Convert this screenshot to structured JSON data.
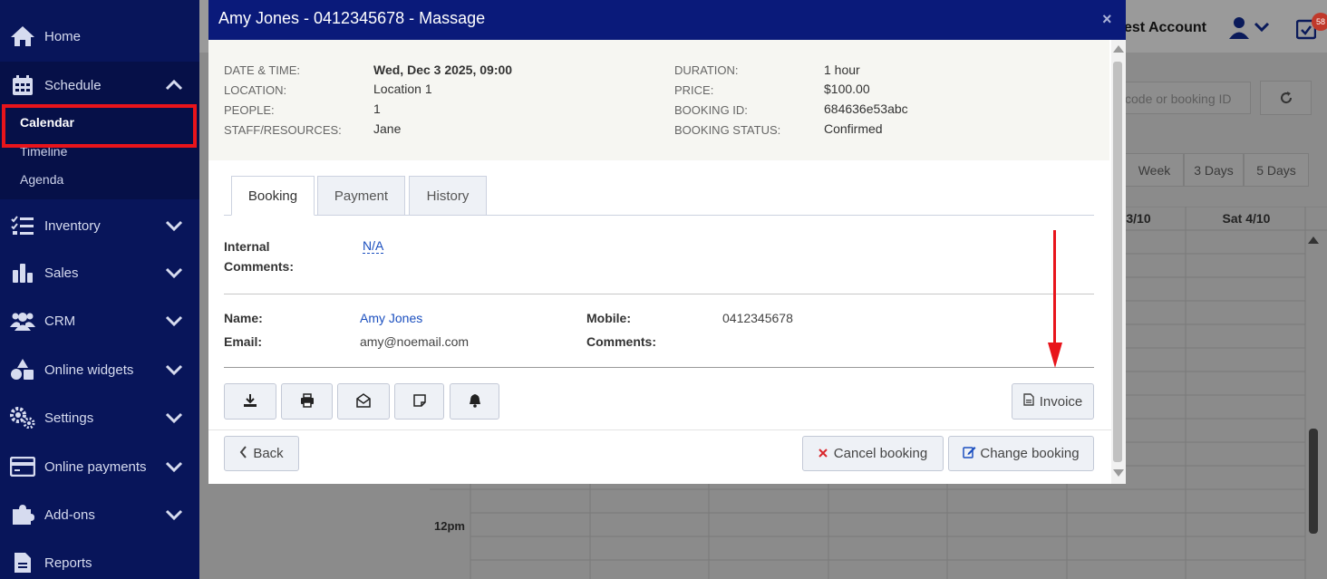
{
  "sidebar": {
    "items": [
      {
        "label": "Home",
        "icon": "home-icon"
      },
      {
        "label": "Schedule",
        "icon": "calendar-grid-icon"
      },
      {
        "label": "Inventory",
        "icon": "checklist-icon"
      },
      {
        "label": "Sales",
        "icon": "bar-chart-icon"
      },
      {
        "label": "CRM",
        "icon": "users-icon"
      },
      {
        "label": "Online widgets",
        "icon": "shapes-icon"
      },
      {
        "label": "Settings",
        "icon": "gears-icon"
      },
      {
        "label": "Online payments",
        "icon": "credit-card-icon"
      },
      {
        "label": "Add-ons",
        "icon": "puzzle-icon"
      },
      {
        "label": "Reports",
        "icon": "document-icon"
      }
    ],
    "schedule_sub": [
      "Calendar",
      "Timeline",
      "Agenda"
    ],
    "active": "Calendar"
  },
  "background": {
    "account": "est Account",
    "badge": "58",
    "search_placeholder": "code or booking ID",
    "views": [
      "Week",
      "3 Days",
      "5 Days"
    ],
    "day_headers": [
      "3/10",
      "Sat 4/10"
    ],
    "time_label": "12pm"
  },
  "modal": {
    "title": "Amy Jones - 0412345678 - Massage",
    "close": "×",
    "info_left": [
      {
        "label": "DATE & TIME:",
        "value": "Wed, Dec 3 2025, 09:00"
      },
      {
        "label": "LOCATION:",
        "value": "Location 1"
      },
      {
        "label": "PEOPLE:",
        "value": "1"
      },
      {
        "label": "STAFF/RESOURCES:",
        "value": "Jane"
      }
    ],
    "info_right": [
      {
        "label": "DURATION:",
        "value": "1 hour"
      },
      {
        "label": "PRICE:",
        "value": "$100.00"
      },
      {
        "label": "BOOKING ID:",
        "value": "684636e53abc"
      },
      {
        "label": "BOOKING STATUS:",
        "value": "Confirmed"
      }
    ],
    "tabs": [
      "Booking",
      "Payment",
      "History"
    ],
    "internal_comments_label": [
      "Internal",
      "Comments:"
    ],
    "internal_comments_value": "N/A",
    "customer": {
      "name_label": "Name:",
      "name": "Amy Jones",
      "email_label": "Email:",
      "email": "amy@noemail.com",
      "mobile_label": "Mobile:",
      "mobile": "0412345678",
      "comments_label": "Comments:"
    },
    "action_icons": [
      "download-icon",
      "print-icon",
      "envelope-open-icon",
      "note-icon",
      "bell-icon"
    ],
    "invoice_label": "Invoice",
    "back_label": "Back",
    "cancel_label": "Cancel booking",
    "change_label": "Change booking"
  },
  "colors": {
    "sidebar": "#08155a",
    "modal_header": "#0a1a7a",
    "annotation": "#e8141b",
    "link": "#1b4fbf"
  }
}
